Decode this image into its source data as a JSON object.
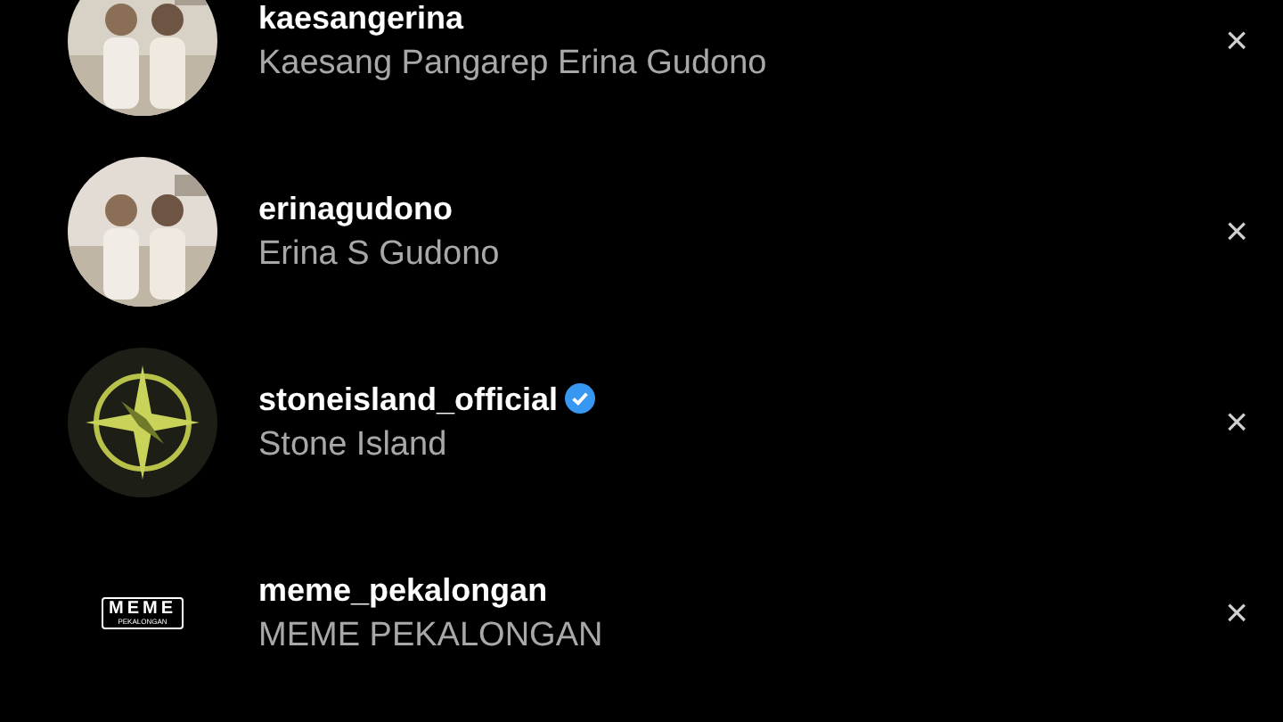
{
  "accounts": [
    {
      "username": "kaesangerina",
      "full_name": "Kaesang Pangarep Erina Gudono",
      "verified": false
    },
    {
      "username": "erinagudono",
      "full_name": "Erina S Gudono",
      "verified": false
    },
    {
      "username": "stoneisland_official",
      "full_name": "Stone Island",
      "verified": true,
      "avatar": {
        "kind": "compass"
      }
    },
    {
      "username": "meme_pekalongan",
      "full_name": "MEME PEKALONGAN",
      "verified": false,
      "avatar": {
        "kind": "logo",
        "title": "MEME",
        "subtitle": "PEKALONGAN"
      }
    }
  ],
  "remove_label": "×"
}
